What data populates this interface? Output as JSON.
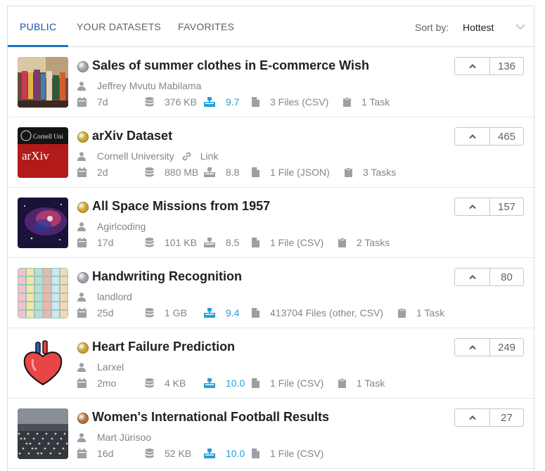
{
  "tabs": [
    {
      "label": "PUBLIC",
      "active": true
    },
    {
      "label": "YOUR DATASETS",
      "active": false
    },
    {
      "label": "FAVORITES",
      "active": false
    }
  ],
  "sort": {
    "label": "Sort by:",
    "value": "Hottest"
  },
  "colors": {
    "accent": "#1a73c8",
    "usability_good": "#20a0d8",
    "gold": "#c9a227",
    "silver": "#9aa0a6",
    "bronze": "#b0713e"
  },
  "datasets": [
    {
      "medal": "silver",
      "title": "Sales of summer clothes in E-commerce Wish",
      "author": "Jeffrey Mvutu Mabilama",
      "link": "",
      "age": "7d",
      "size": "376 KB",
      "usability": "9.7",
      "usability_good": true,
      "files": "3 Files (CSV)",
      "tasks": "1 Task",
      "votes": "136",
      "thumb": "clothes-rack-photo"
    },
    {
      "medal": "gold",
      "title": "arXiv Dataset",
      "author": "Cornell University",
      "link": "Link",
      "age": "2d",
      "size": "880 MB",
      "usability": "8.8",
      "usability_good": false,
      "files": "1 File (JSON)",
      "tasks": "3 Tasks",
      "votes": "465",
      "thumb": "arxiv-logo",
      "thumb_text": {
        "top": "Cornell Uni",
        "main": "arXiv"
      }
    },
    {
      "medal": "gold",
      "title": "All Space Missions from 1957",
      "author": "Agirlcoding",
      "link": "",
      "age": "17d",
      "size": "101 KB",
      "usability": "8.5",
      "usability_good": false,
      "files": "1 File (CSV)",
      "tasks": "2 Tasks",
      "votes": "157",
      "thumb": "nebula-photo"
    },
    {
      "medal": "silver",
      "title": "Handwriting Recognition",
      "author": "landlord",
      "link": "",
      "age": "25d",
      "size": "1 GB",
      "usability": "9.4",
      "usability_good": true,
      "files": "413704 Files (other, CSV)",
      "tasks": "1 Task",
      "votes": "80",
      "thumb": "sticky-notes-photo"
    },
    {
      "medal": "gold",
      "title": "Heart Failure Prediction",
      "author": "Larxel",
      "link": "",
      "age": "2mo",
      "size": "4 KB",
      "usability": "10.0",
      "usability_good": true,
      "files": "1 File (CSV)",
      "tasks": "1 Task",
      "votes": "249",
      "thumb": "heart-illustration"
    },
    {
      "medal": "bronze",
      "title": "Women's International Football Results",
      "author": "Mart Jürisoo",
      "link": "",
      "age": "16d",
      "size": "52 KB",
      "usability": "10.0",
      "usability_good": true,
      "files": "1 File (CSV)",
      "tasks": "",
      "votes": "27",
      "thumb": "stadium-crowd-photo"
    }
  ]
}
